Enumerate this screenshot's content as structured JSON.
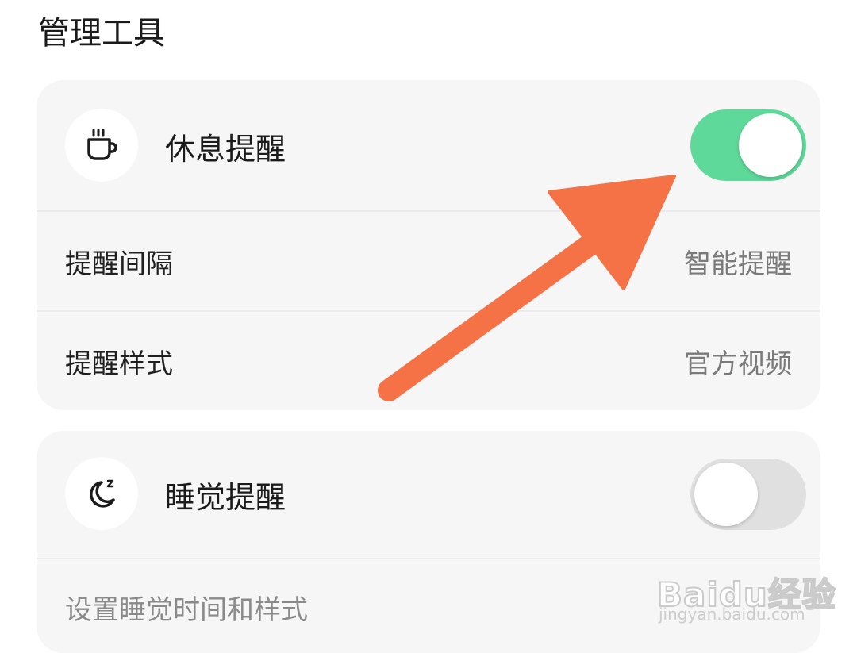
{
  "section": {
    "title": "管理工具"
  },
  "rest_card": {
    "icon": "coffee-cup-icon",
    "title": "休息提醒",
    "toggle_state": "on",
    "rows": [
      {
        "label": "提醒间隔",
        "value": "智能提醒"
      },
      {
        "label": "提醒样式",
        "value": "官方视频"
      }
    ]
  },
  "sleep_card": {
    "icon": "moon-sleep-icon",
    "title": "睡觉提醒",
    "toggle_state": "off",
    "hint": "设置睡觉时间和样式"
  },
  "annotation": {
    "type": "arrow",
    "color": "#f57146",
    "points_to": "rest-reminder-toggle"
  },
  "watermark": {
    "logo": "Baidu经验",
    "url": "jingyan.baidu.com"
  },
  "colors": {
    "toggle_on": "#5fd99a",
    "toggle_off": "#e0e0e0",
    "card_bg": "#f6f6f6",
    "arrow": "#f57146"
  }
}
